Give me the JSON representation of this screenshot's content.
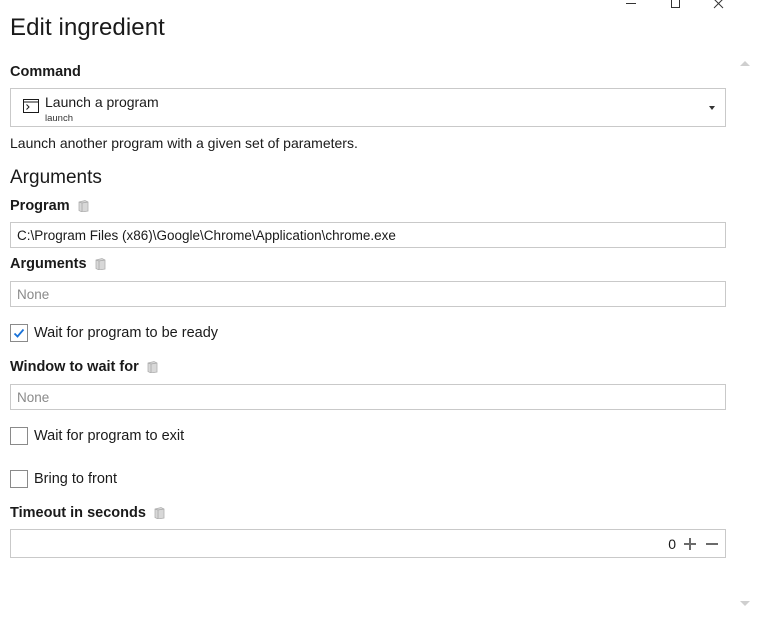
{
  "window": {
    "title": "Edit ingredient"
  },
  "command": {
    "label": "Command",
    "selected_title": "Launch a program",
    "selected_subtitle": "launch",
    "description": "Launch another program with a given set of parameters."
  },
  "arguments_section": {
    "title": "Arguments"
  },
  "program": {
    "label": "Program",
    "value": "C:\\Program Files (x86)\\Google\\Chrome\\Application\\chrome.exe"
  },
  "arguments": {
    "label": "Arguments",
    "placeholder": "None"
  },
  "wait_ready": {
    "label": "Wait for program to be ready",
    "checked": true
  },
  "window_wait": {
    "label": "Window to wait for",
    "placeholder": "None"
  },
  "wait_exit": {
    "label": "Wait for program to exit",
    "checked": false
  },
  "bring_front": {
    "label": "Bring to front",
    "checked": false
  },
  "timeout": {
    "label": "Timeout in seconds",
    "value": "0"
  },
  "colors": {
    "accent": "#1a73d9",
    "border": "#c9c9c9",
    "text": "#1a1a1a"
  }
}
